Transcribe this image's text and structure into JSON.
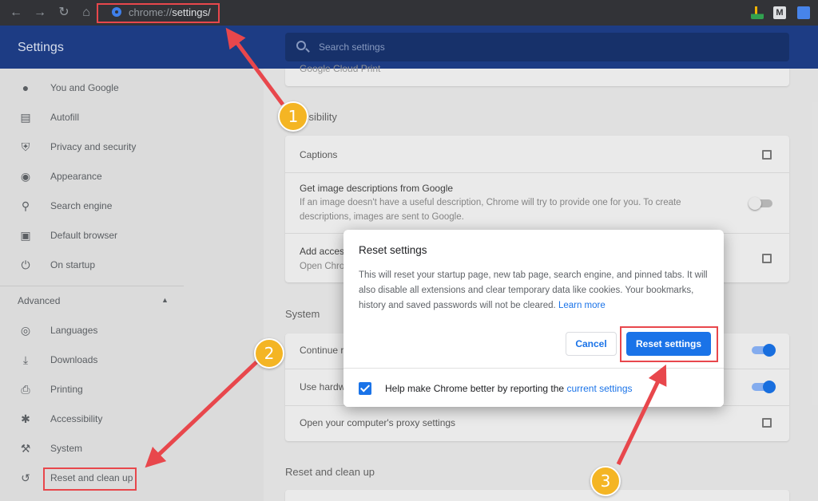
{
  "browser": {
    "url_prefix": "chrome://",
    "url_path": "settings/"
  },
  "header": {
    "title": "Settings",
    "search_placeholder": "Search settings"
  },
  "sidebar": {
    "items": [
      {
        "label": "You and Google",
        "icon": "person-icon"
      },
      {
        "label": "Autofill",
        "icon": "clipboard-icon"
      },
      {
        "label": "Privacy and security",
        "icon": "shield-icon"
      },
      {
        "label": "Appearance",
        "icon": "palette-icon"
      },
      {
        "label": "Search engine",
        "icon": "search-icon"
      },
      {
        "label": "Default browser",
        "icon": "browser-icon"
      },
      {
        "label": "On startup",
        "icon": "power-icon"
      }
    ],
    "advanced_label": "Advanced",
    "advanced_items": [
      {
        "label": "Languages",
        "icon": "globe-icon"
      },
      {
        "label": "Downloads",
        "icon": "download-icon"
      },
      {
        "label": "Printing",
        "icon": "printer-icon"
      },
      {
        "label": "Accessibility",
        "icon": "accessibility-icon"
      },
      {
        "label": "System",
        "icon": "wrench-icon"
      },
      {
        "label": "Reset and clean up",
        "icon": "history-icon"
      }
    ]
  },
  "main": {
    "cloud_print_label": "Google Cloud Print",
    "accessibility_title": "ssibility",
    "captions_label": "Captions",
    "image_desc_title": "Get image descriptions from Google",
    "image_desc_sub_1": "If an image doesn't have a useful description, Chrome will try to provide one for you. To create",
    "image_desc_sub_2": "descriptions, images are sent to Google.",
    "add_access_label": "Add acces",
    "add_access_sub": "Open Chro",
    "system_title": "System",
    "continue_label": "Continue r",
    "hardware_label": "Use hardw",
    "proxy_label": "Open your computer's proxy settings",
    "reset_section_title": "Reset and clean up"
  },
  "dialog": {
    "title": "Reset settings",
    "body": "This will reset your startup page, new tab page, search engine, and pinned tabs. It will also disable all extensions and clear temporary data like cookies. Your bookmarks, history and saved passwords will not be cleared.",
    "learn_more": "Learn more",
    "cancel_label": "Cancel",
    "reset_label": "Reset settings",
    "footer_text": "Help make Chrome better by reporting the",
    "footer_link": "current settings",
    "checkbox_checked": true
  },
  "annotations": {
    "badge_1": "1",
    "badge_2": "2",
    "badge_3": "3"
  },
  "colors": {
    "header_bg": "#1f3f8a",
    "accent": "#1a73e8",
    "highlight": "#e8474c",
    "badge": "#f4b524"
  }
}
